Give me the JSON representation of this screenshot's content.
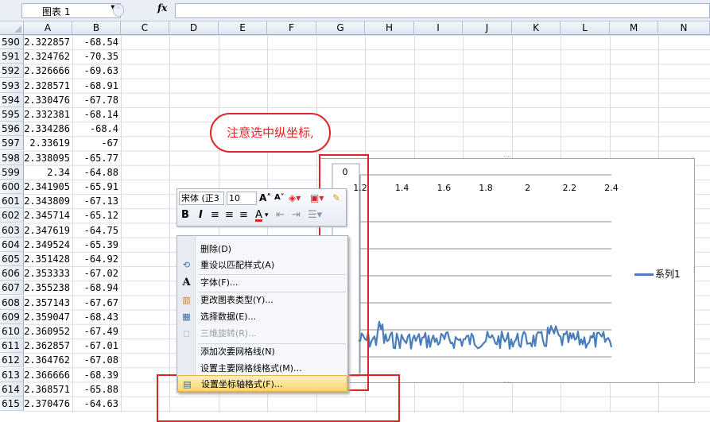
{
  "formula_bar": {
    "name_box": "图表 1",
    "fx_label": "fx",
    "value": ""
  },
  "columns": [
    "A",
    "B",
    "C",
    "D",
    "E",
    "F",
    "G",
    "H",
    "I",
    "J",
    "K",
    "L",
    "M",
    "N"
  ],
  "rows": [
    {
      "n": "590",
      "a": "2.322857",
      "b": "-68.54"
    },
    {
      "n": "591",
      "a": "2.324762",
      "b": "-70.35"
    },
    {
      "n": "592",
      "a": "2.326666",
      "b": "-69.63"
    },
    {
      "n": "593",
      "a": "2.328571",
      "b": "-68.91"
    },
    {
      "n": "594",
      "a": "2.330476",
      "b": "-67.78"
    },
    {
      "n": "595",
      "a": "2.332381",
      "b": "-68.14"
    },
    {
      "n": "596",
      "a": "2.334286",
      "b": "-68.4"
    },
    {
      "n": "597",
      "a": "2.33619",
      "b": "-67"
    },
    {
      "n": "598",
      "a": "2.338095",
      "b": "-65.77"
    },
    {
      "n": "599",
      "a": "2.34",
      "b": "-64.88"
    },
    {
      "n": "600",
      "a": "2.341905",
      "b": "-65.91"
    },
    {
      "n": "601",
      "a": "2.343809",
      "b": "-67.13"
    },
    {
      "n": "602",
      "a": "2.345714",
      "b": "-65.12"
    },
    {
      "n": "603",
      "a": "2.347619",
      "b": "-64.75"
    },
    {
      "n": "604",
      "a": "2.349524",
      "b": "-65.39"
    },
    {
      "n": "605",
      "a": "2.351428",
      "b": "-64.92"
    },
    {
      "n": "606",
      "a": "2.353333",
      "b": "-67.02"
    },
    {
      "n": "607",
      "a": "2.355238",
      "b": "-68.94"
    },
    {
      "n": "608",
      "a": "2.357143",
      "b": "-67.67"
    },
    {
      "n": "609",
      "a": "2.359047",
      "b": "-68.43"
    },
    {
      "n": "610",
      "a": "2.360952",
      "b": "-67.49"
    },
    {
      "n": "611",
      "a": "2.362857",
      "b": "-67.01"
    },
    {
      "n": "612",
      "a": "2.364762",
      "b": "-67.08"
    },
    {
      "n": "613",
      "a": "2.366666",
      "b": "-68.39"
    },
    {
      "n": "614",
      "a": "2.368571",
      "b": "-65.88"
    },
    {
      "n": "615",
      "a": "2.370476",
      "b": "-64.63"
    }
  ],
  "annotation": {
    "callout_text": "注意选中纵坐标,"
  },
  "mini_toolbar": {
    "font": "宋体 (正3",
    "size": "10",
    "bold": "B",
    "italic": "I",
    "font_color": "A"
  },
  "context_menu": {
    "items": [
      {
        "label": "删除(D)",
        "icon": "",
        "disabled": false
      },
      {
        "label": "重设以匹配样式(A)",
        "icon": "reset-style-icon",
        "disabled": false
      },
      {
        "label": "字体(F)...",
        "icon": "font-icon",
        "disabled": false
      },
      {
        "label": "更改图表类型(Y)...",
        "icon": "chart-type-icon",
        "disabled": false
      },
      {
        "label": "选择数据(E)...",
        "icon": "select-data-icon",
        "disabled": false
      },
      {
        "label": "三维旋转(R)...",
        "icon": "3d-rotate-icon",
        "disabled": true
      },
      {
        "label": "添加次要网格线(N)",
        "icon": "",
        "disabled": false
      },
      {
        "label": "设置主要网格线格式(M)...",
        "icon": "",
        "disabled": false
      },
      {
        "label": "设置坐标轴格式(F)...",
        "icon": "format-axis-icon",
        "disabled": false,
        "highlighted": true
      }
    ]
  },
  "chart_data": {
    "type": "line",
    "x_ticks": [
      "1.2",
      "1.4",
      "1.6",
      "1.8",
      "2",
      "2.2",
      "2.4"
    ],
    "y_ticks": [
      "0"
    ],
    "xlim": [
      1.2,
      2.4
    ],
    "series": [
      {
        "name": "系列1",
        "color": "#4a7ebb"
      }
    ],
    "legend_position": "right",
    "grid": true
  }
}
